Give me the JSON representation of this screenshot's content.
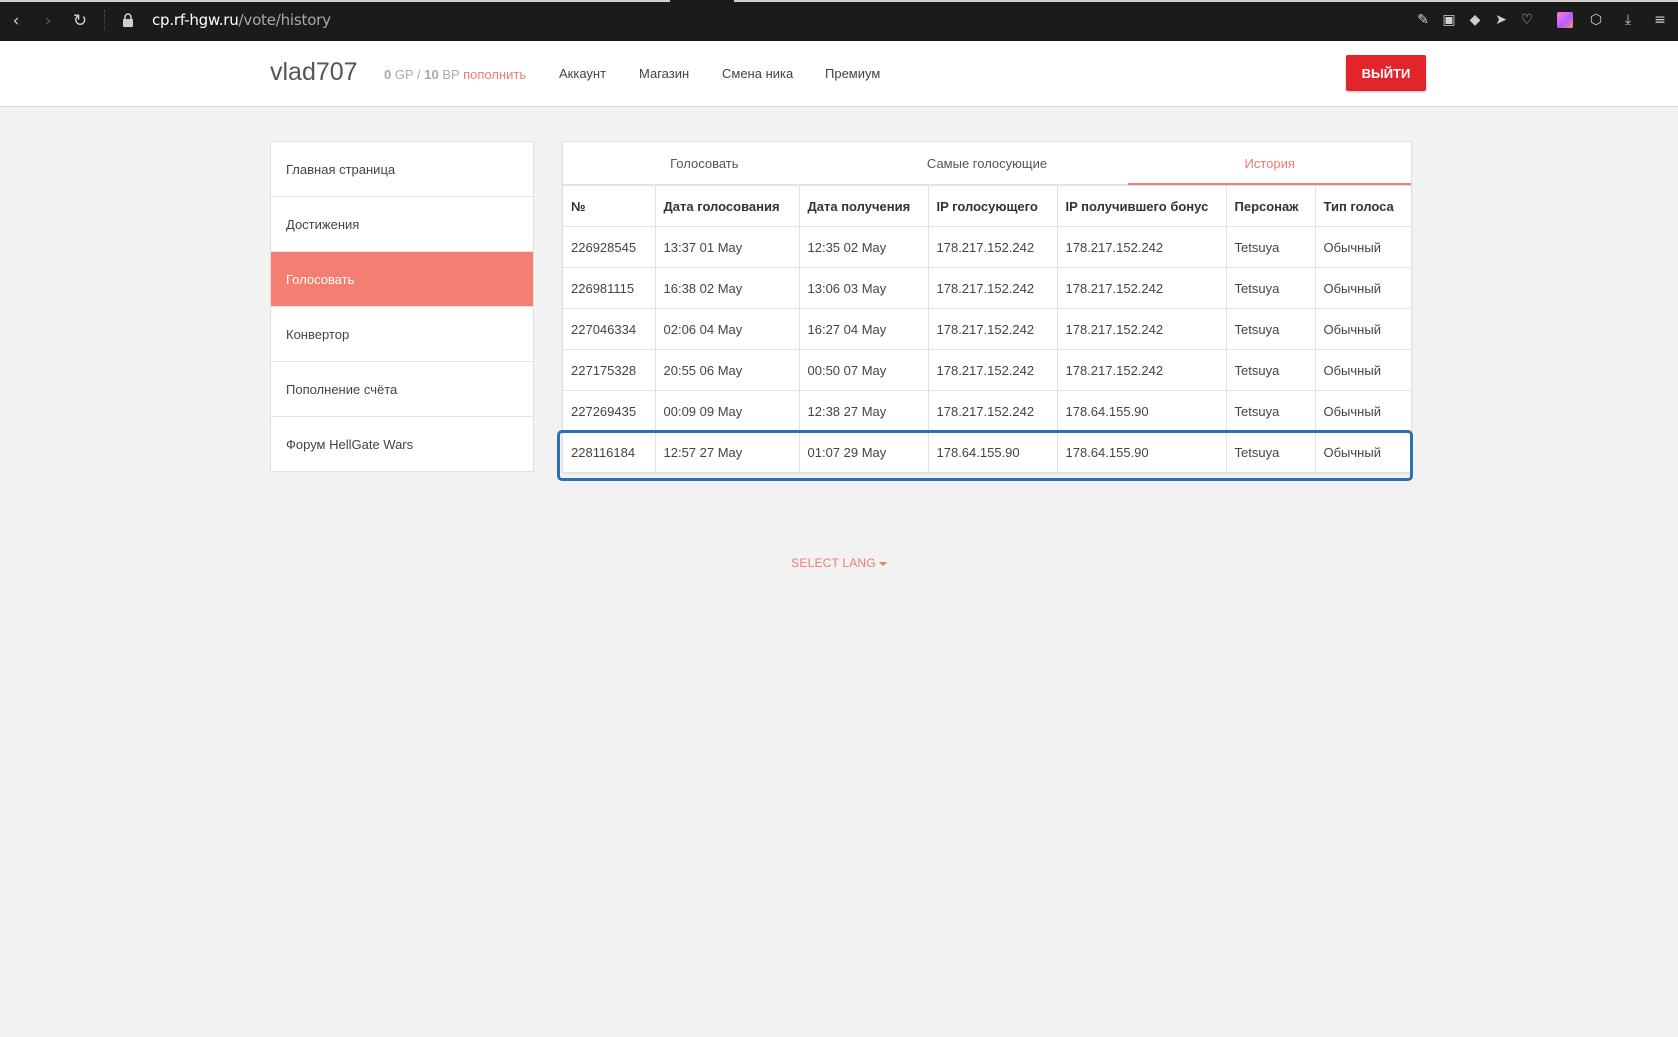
{
  "browser": {
    "url_host": "cp.rf-hgw.ru",
    "url_path": "/vote/history"
  },
  "header": {
    "username": "vlad707",
    "balance": {
      "gp_value": "0",
      "gp_unit": "GP",
      "separator": "/",
      "bp_value": "10",
      "bp_unit": "BP",
      "topup_label": "пополнить"
    },
    "menu": [
      "Аккаунт",
      "Магазин",
      "Смена ника",
      "Премиум"
    ],
    "logout_label": "ВЫЙТИ"
  },
  "sidebar": {
    "items": [
      {
        "label": "Главная страница",
        "active": false
      },
      {
        "label": "Достижения",
        "active": false
      },
      {
        "label": "Голосовать",
        "active": true
      },
      {
        "label": "Конвертор",
        "active": false
      },
      {
        "label": "Пополнение счёта",
        "active": false
      },
      {
        "label": "Форум HellGate Wars",
        "active": false
      }
    ]
  },
  "tabs": [
    {
      "label": "Голосовать",
      "active": false
    },
    {
      "label": "Самые голосующие",
      "active": false
    },
    {
      "label": "История",
      "active": true
    }
  ],
  "table": {
    "columns": [
      "№",
      "Дата голосования",
      "Дата получения",
      "IP голосующего",
      "IP получившего бонус",
      "Персонаж",
      "Тип голоса"
    ],
    "rows": [
      [
        "226928545",
        "13:37 01 May",
        "12:35 02 May",
        "178.217.152.242",
        "178.217.152.242",
        "Tetsuya",
        "Обычный"
      ],
      [
        "226981115",
        "16:38 02 May",
        "13:06 03 May",
        "178.217.152.242",
        "178.217.152.242",
        "Tetsuya",
        "Обычный"
      ],
      [
        "227046334",
        "02:06 04 May",
        "16:27 04 May",
        "178.217.152.242",
        "178.217.152.242",
        "Tetsuya",
        "Обычный"
      ],
      [
        "227175328",
        "20:55 06 May",
        "00:50 07 May",
        "178.217.152.242",
        "178.217.152.242",
        "Tetsuya",
        "Обычный"
      ],
      [
        "227269435",
        "00:09 09 May",
        "12:38 27 May",
        "178.217.152.242",
        "178.64.155.90",
        "Tetsuya",
        "Обычный"
      ],
      [
        "228116184",
        "12:57 27 May",
        "01:07 29 May",
        "178.64.155.90",
        "178.64.155.90",
        "Tetsuya",
        "Обычный"
      ]
    ]
  },
  "footer": {
    "select_lang": "SELECT LANG"
  },
  "colors": {
    "accent": "#f07b6e",
    "active_sidebar": "#f47e71",
    "logout": "#e3242b",
    "highlight": "#2f6db5"
  }
}
